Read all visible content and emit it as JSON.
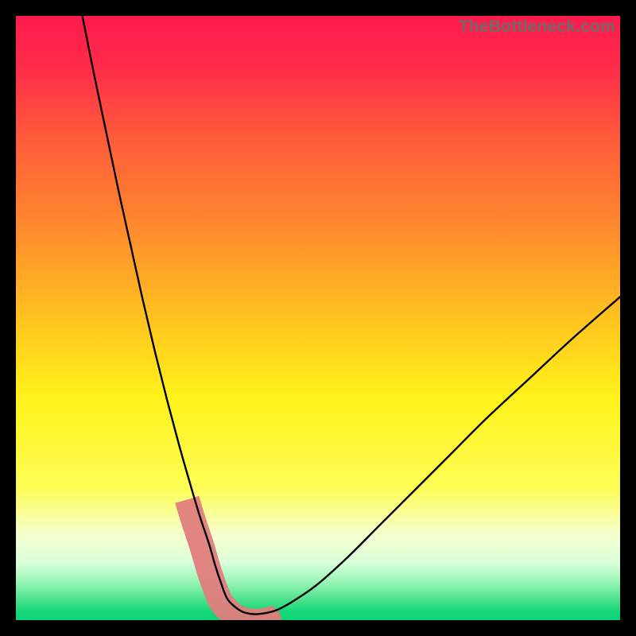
{
  "watermark": "TheBottleneck.com",
  "chart_data": {
    "type": "line",
    "title": "",
    "xlabel": "",
    "ylabel": "",
    "xlim": [
      0,
      100
    ],
    "ylim": [
      0,
      100
    ],
    "grid": false,
    "series": [
      {
        "name": "bottleneck-curve",
        "x": [
          11,
          13,
          15,
          17,
          19,
          21,
          23,
          25,
          27,
          29,
          30.5,
          32,
          33,
          34,
          35,
          36.5,
          38,
          40,
          43,
          46,
          50,
          55,
          60,
          66,
          72,
          78,
          85,
          92,
          100
        ],
        "y": [
          100,
          90,
          80.5,
          71,
          62,
          53,
          44.5,
          36.5,
          29,
          22,
          17,
          12.5,
          9,
          6,
          3.5,
          2,
          1.2,
          1,
          1.6,
          3.2,
          6,
          10.5,
          15.5,
          21.5,
          27.5,
          33.5,
          40,
          46.5,
          53.5
        ]
      }
    ],
    "highlight_region": {
      "name": "pink-band",
      "x_range": [
        29.5,
        43
      ],
      "y_range_approx": [
        0,
        18
      ]
    },
    "background_gradient": {
      "stops": [
        {
          "pos": 0.0,
          "color": "#ff1a4d"
        },
        {
          "pos": 0.08,
          "color": "#ff2a4a"
        },
        {
          "pos": 0.2,
          "color": "#ff5a3a"
        },
        {
          "pos": 0.35,
          "color": "#ff8a2e"
        },
        {
          "pos": 0.5,
          "color": "#ffc21f"
        },
        {
          "pos": 0.63,
          "color": "#fff21a"
        },
        {
          "pos": 0.78,
          "color": "#fdfd55"
        },
        {
          "pos": 0.86,
          "color": "#f6ffd0"
        },
        {
          "pos": 0.905,
          "color": "#d9ffd9"
        },
        {
          "pos": 0.935,
          "color": "#9cf7b9"
        },
        {
          "pos": 0.965,
          "color": "#4fe28d"
        },
        {
          "pos": 0.985,
          "color": "#17d87a"
        },
        {
          "pos": 1.0,
          "color": "#0bd474"
        }
      ]
    }
  }
}
